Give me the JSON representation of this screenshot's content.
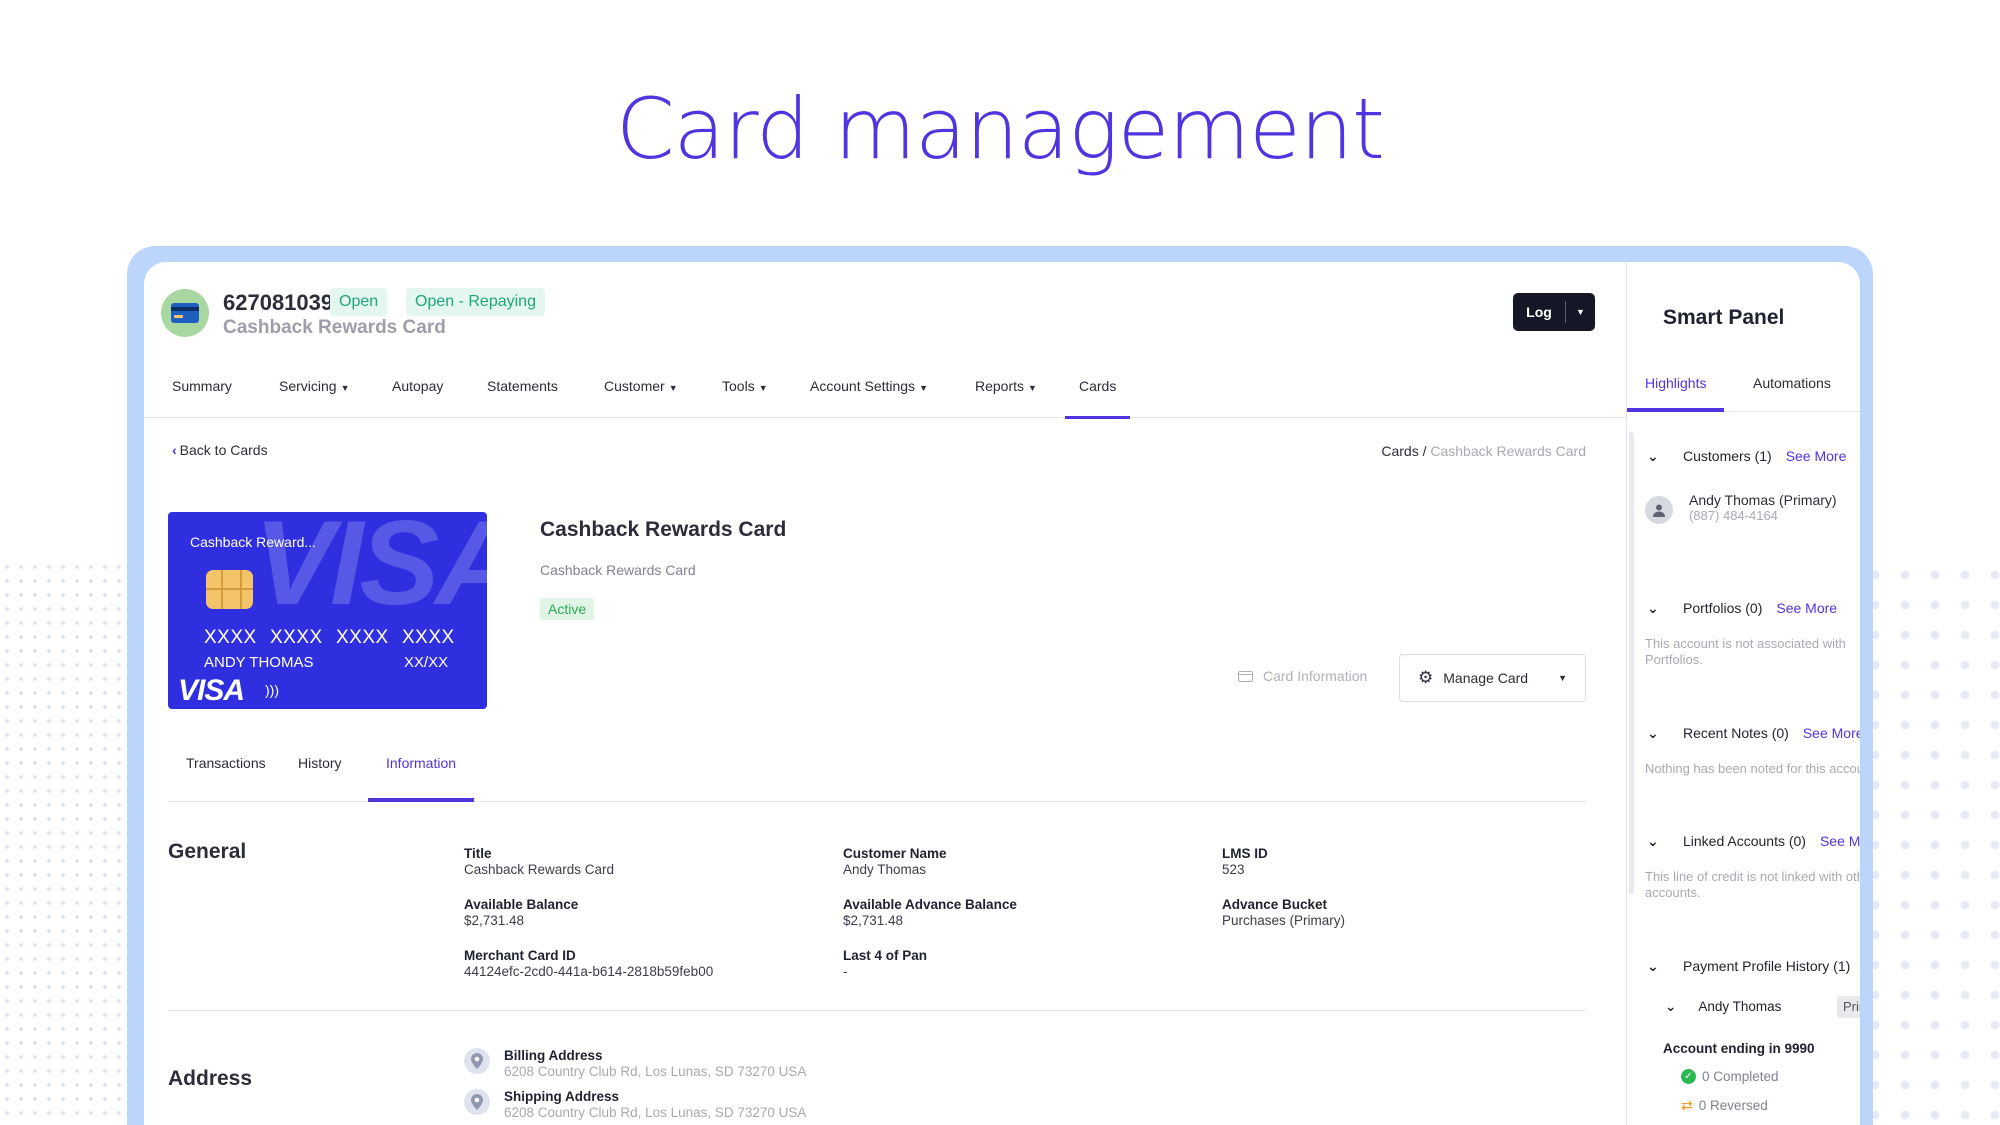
{
  "page_title": "Card management",
  "account": {
    "number": "627081039",
    "status_badges": [
      "Open",
      "Open - Repaying"
    ],
    "product_name": "Cashback Rewards Card",
    "log_button": "Log"
  },
  "nav": {
    "tabs": [
      {
        "label": "Summary"
      },
      {
        "label": "Servicing",
        "dropdown": true
      },
      {
        "label": "Autopay"
      },
      {
        "label": "Statements"
      },
      {
        "label": "Customer",
        "dropdown": true
      },
      {
        "label": "Tools",
        "dropdown": true
      },
      {
        "label": "Account Settings",
        "dropdown": true
      },
      {
        "label": "Reports",
        "dropdown": true
      },
      {
        "label": "Cards",
        "active": true
      }
    ]
  },
  "back_link": "Back to Cards",
  "breadcrumb": {
    "root": "Cards",
    "separator": "/",
    "current": "Cashback Rewards Card"
  },
  "card": {
    "visual_name": "Cashback Reward...",
    "number_groups": [
      "XXXX",
      "XXXX",
      "XXXX",
      "XXXX"
    ],
    "holder": "ANDY THOMAS",
    "expiry": "XX/XX",
    "network": "VISA",
    "title": "Cashback Rewards Card",
    "subtitle": "Cashback Rewards Card",
    "status": "Active",
    "info_link": "Card Information",
    "manage_button": "Manage Card"
  },
  "subtabs": [
    "Transactions",
    "History",
    "Information"
  ],
  "general": {
    "title": "General",
    "fields": [
      {
        "label": "Title",
        "value": "Cashback Rewards Card"
      },
      {
        "label": "Customer Name",
        "value": "Andy Thomas"
      },
      {
        "label": "LMS ID",
        "value": "523"
      },
      {
        "label": "Available Balance",
        "value": "$2,731.48"
      },
      {
        "label": "Available Advance Balance",
        "value": "$2,731.48"
      },
      {
        "label": "Advance Bucket",
        "value": "Purchases (Primary)"
      },
      {
        "label": "Merchant Card ID",
        "value": "44124efc-2cd0-441a-b614-2818b59feb00"
      },
      {
        "label": "Last 4 of Pan",
        "value": "-"
      }
    ]
  },
  "address": {
    "title": "Address",
    "items": [
      {
        "label": "Billing Address",
        "value": "6208 Country Club Rd, Los Lunas, SD 73270 USA"
      },
      {
        "label": "Shipping Address",
        "value": "6208 Country Club Rd, Los Lunas, SD 73270 USA"
      }
    ]
  },
  "smart_panel": {
    "title": "Smart Panel",
    "tabs": [
      "Highlights",
      "Automations"
    ],
    "sections": {
      "customers": {
        "title": "Customers (1)",
        "more": "See More"
      },
      "portfolios": {
        "title": "Portfolios (0)",
        "more": "See More",
        "empty": "This account is not associated with Portfolios."
      },
      "notes": {
        "title": "Recent Notes (0)",
        "more": "See More",
        "empty": "Nothing has been noted for this account."
      },
      "linked": {
        "title": "Linked Accounts (0)",
        "more": "See More",
        "empty": "This line of credit is not linked with other accounts."
      },
      "payment": {
        "title": "Payment Profile History (1)"
      }
    },
    "customer": {
      "name": "Andy Thomas (Primary)",
      "phone": "(887) 484-4164"
    },
    "payment_profile": {
      "holder": "Andy Thomas",
      "tag": "Primary",
      "account": "Account ending in 9990",
      "completed": "0 Completed",
      "reversed": "0 Reversed"
    }
  },
  "colors": {
    "accent": "#4f35e0",
    "frame": "#bcd6fb",
    "card_blue": "#2f2fe0",
    "open_badge": "#1fa67a",
    "active_badge": "#2bab55"
  }
}
